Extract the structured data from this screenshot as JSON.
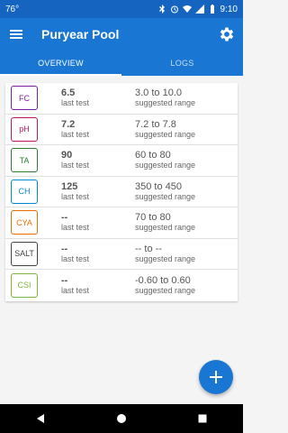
{
  "status_bar": {
    "temperature": "76°",
    "time": "9:10"
  },
  "app_bar": {
    "title": "Puryear Pool"
  },
  "tabs": [
    {
      "label": "OVERVIEW",
      "active": true
    },
    {
      "label": "LOGS",
      "active": false
    }
  ],
  "metrics": [
    {
      "code": "FC",
      "color": "#7b1fa2",
      "value": "6.5",
      "value_caption": "last test",
      "range": "3.0 to 10.0",
      "range_caption": "suggested range"
    },
    {
      "code": "pH",
      "color": "#c2185b",
      "value": "7.2",
      "value_caption": "last test",
      "range": "7.2 to 7.8",
      "range_caption": "suggested range"
    },
    {
      "code": "TA",
      "color": "#2e7d32",
      "value": "90",
      "value_caption": "last test",
      "range": "60 to 80",
      "range_caption": "suggested range"
    },
    {
      "code": "CH",
      "color": "#0288d1",
      "value": "125",
      "value_caption": "last test",
      "range": "350 to 450",
      "range_caption": "suggested range"
    },
    {
      "code": "CYA",
      "color": "#ef6c00",
      "value": "--",
      "value_caption": "last test",
      "range": "70 to 80",
      "range_caption": "suggested range"
    },
    {
      "code": "SALT",
      "color": "#424242",
      "value": "--",
      "value_caption": "last test",
      "range": "-- to --",
      "range_caption": "suggested range"
    },
    {
      "code": "CSI",
      "color": "#7cb342",
      "value": "--",
      "value_caption": "last test",
      "range": "-0.60 to 0.60",
      "range_caption": "suggested range"
    }
  ],
  "icons": {
    "menu": "menu-icon",
    "settings": "gear-icon",
    "fab": "plus-icon",
    "nav_back": "back-triangle-icon",
    "nav_home": "home-circle-icon",
    "nav_recents": "recents-square-icon"
  },
  "colors": {
    "primary": "#1976d2",
    "status_bar": "#1565c0"
  }
}
